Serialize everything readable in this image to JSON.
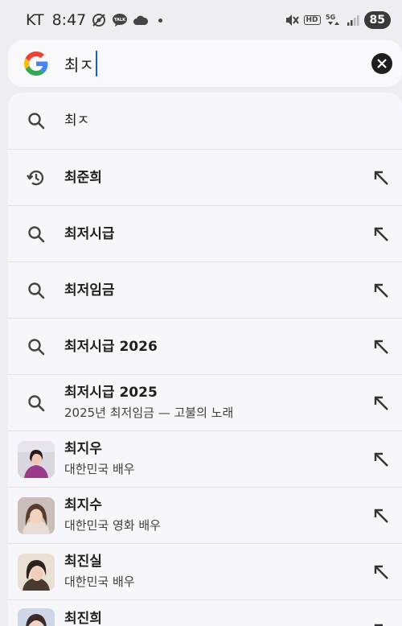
{
  "status_bar": {
    "carrier": "KT",
    "time": "8:47",
    "talk_label": "TALK",
    "hd_label": "HD",
    "network_label": "5G",
    "battery": "85"
  },
  "search": {
    "query": "최ㅈ"
  },
  "suggestions": [
    {
      "title": "최ㅈ",
      "subtitle": "",
      "icon": "search-icon"
    },
    {
      "title": "최준희",
      "subtitle": "",
      "icon": "history-icon"
    },
    {
      "title": "최저시급",
      "subtitle": "",
      "icon": "search-icon"
    },
    {
      "title": "최저임금",
      "subtitle": "",
      "icon": "search-icon"
    },
    {
      "title": "최저시급 2026",
      "subtitle": "",
      "icon": "search-icon"
    },
    {
      "title": "최저시급 2025",
      "subtitle": "2025년 최저임금 — 고불의 노래",
      "icon": "search-icon"
    },
    {
      "title": "최지우",
      "subtitle": "대한민국 배우",
      "icon": "person-thumbnail"
    },
    {
      "title": "최지수",
      "subtitle": "대한민국 영화 배우",
      "icon": "person-thumbnail"
    },
    {
      "title": "최진실",
      "subtitle": "대한민국 배우",
      "icon": "person-thumbnail"
    },
    {
      "title": "최진희",
      "subtitle": "",
      "icon": "person-thumbnail"
    }
  ],
  "colors": {
    "background": "#eeedf2",
    "panel": "#f7f6fb",
    "caret": "#1a5cd8",
    "google_blue": "#4285F4",
    "google_red": "#EA4335",
    "google_yellow": "#FBBC05",
    "google_green": "#34A853"
  }
}
